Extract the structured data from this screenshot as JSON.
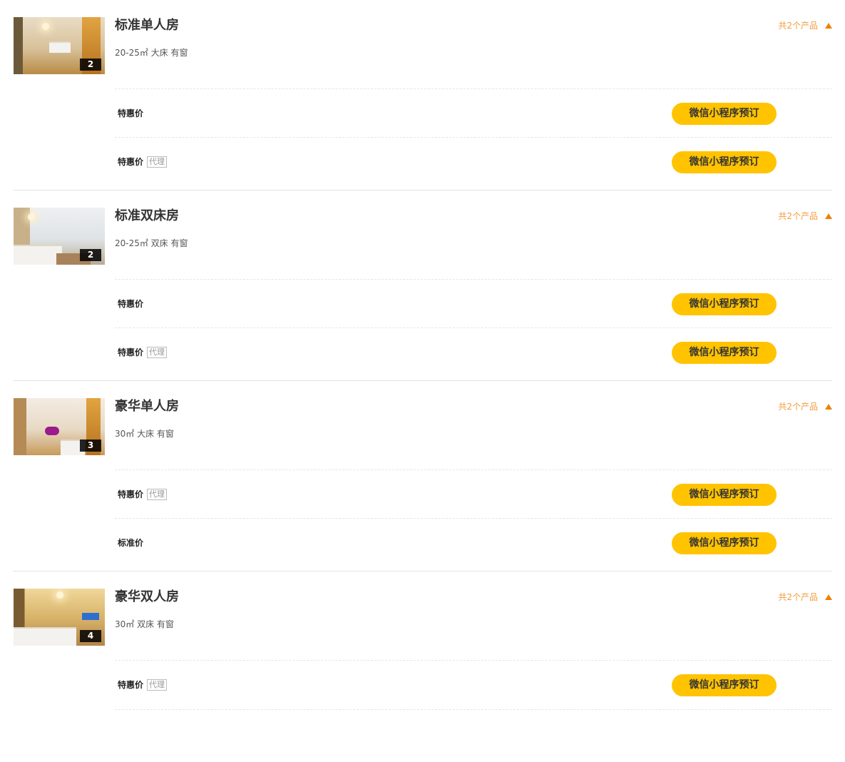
{
  "colors": {
    "accent": "#ffc300",
    "orange": "#f39c3c",
    "arrow": "#f08000",
    "divider": "#e3e3e3"
  },
  "rooms": [
    {
      "name": "标准单人房",
      "desc": "20-25㎡ 大床 有窗",
      "photo_count": "2",
      "total_label": "共2个产品",
      "products": [
        {
          "price_name": "特惠价",
          "tag": "",
          "button": "微信小程序预订"
        },
        {
          "price_name": "特惠价",
          "tag": "代理",
          "button": "微信小程序预订"
        }
      ]
    },
    {
      "name": "标准双床房",
      "desc": "20-25㎡ 双床 有窗",
      "photo_count": "2",
      "total_label": "共2个产品",
      "products": [
        {
          "price_name": "特惠价",
          "tag": "",
          "button": "微信小程序预订"
        },
        {
          "price_name": "特惠价",
          "tag": "代理",
          "button": "微信小程序预订"
        }
      ]
    },
    {
      "name": "豪华单人房",
      "desc": "30㎡ 大床 有窗",
      "photo_count": "3",
      "total_label": "共2个产品",
      "products": [
        {
          "price_name": "特惠价",
          "tag": "代理",
          "button": "微信小程序预订"
        },
        {
          "price_name": "标准价",
          "tag": "",
          "button": "微信小程序预订"
        }
      ]
    },
    {
      "name": "豪华双人房",
      "desc": "30㎡ 双床 有窗",
      "photo_count": "4",
      "total_label": "共2个产品",
      "products": [
        {
          "price_name": "特惠价",
          "tag": "代理",
          "button": "微信小程序预订"
        }
      ]
    }
  ]
}
